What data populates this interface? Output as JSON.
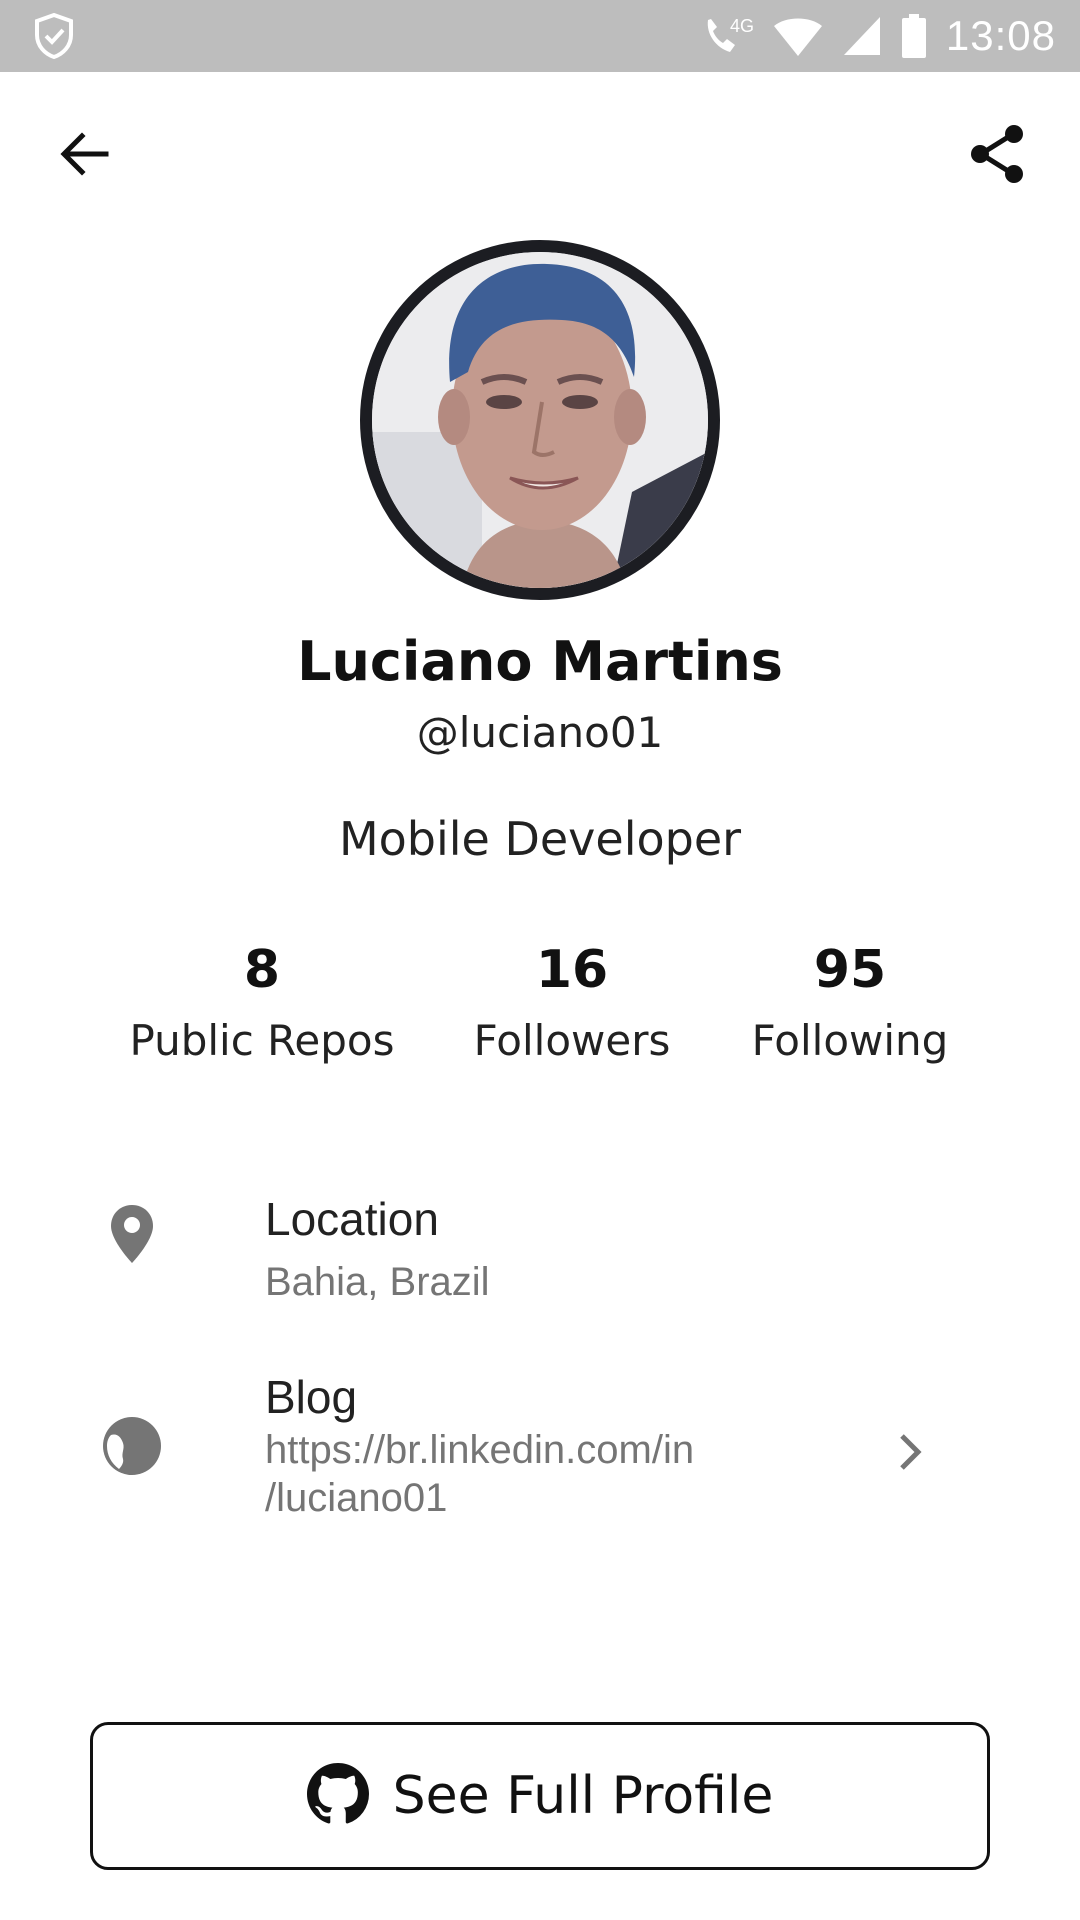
{
  "status_bar": {
    "time": "13:08",
    "network_label": "4G",
    "icons": [
      "shield-check-icon",
      "wifi-call-icon",
      "wifi-icon",
      "cellular-signal-icon",
      "battery-icon"
    ]
  },
  "app_bar": {
    "back_icon": "arrow-left-icon",
    "share_icon": "share-icon"
  },
  "profile": {
    "name": "Luciano Martins",
    "username": "@luciano01",
    "bio": "Mobile Developer"
  },
  "stats": [
    {
      "value": "8",
      "label": "Public Repos"
    },
    {
      "value": "16",
      "label": "Followers"
    },
    {
      "value": "95",
      "label": "Following"
    }
  ],
  "info": {
    "location": {
      "icon": "location-pin-icon",
      "title": "Location",
      "value": "Bahia, Brazil"
    },
    "blog": {
      "icon": "globe-icon",
      "title": "Blog",
      "value_line1": "https://br.linkedin.com/in",
      "value_line2": "/luciano01",
      "action_icon": "chevron-right-icon"
    }
  },
  "actions": {
    "full_profile_label": "See Full Profile",
    "full_profile_icon": "github-icon"
  },
  "colors": {
    "status_bar_bg": "#bdbdbd",
    "text_primary": "#111111",
    "text_secondary": "#757575",
    "icon_gray": "#757575",
    "avatar_border": "#1c1d22"
  }
}
